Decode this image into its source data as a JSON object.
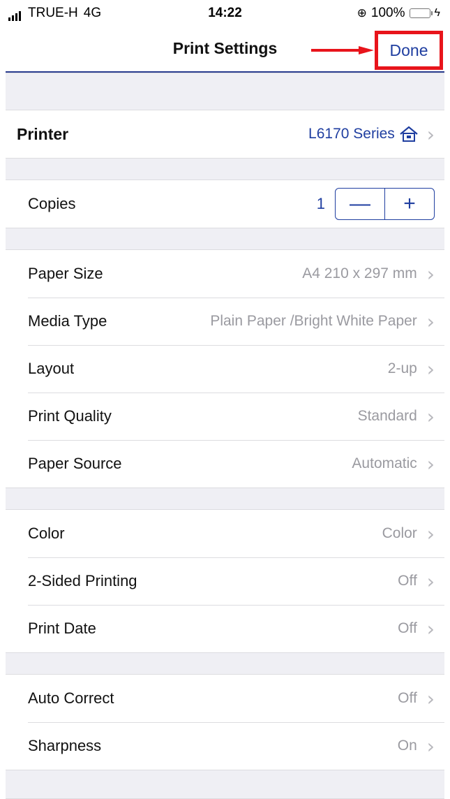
{
  "status_bar": {
    "carrier": "TRUE-H",
    "network": "4G",
    "time": "14:22",
    "battery": "100%"
  },
  "nav": {
    "title": "Print Settings",
    "done_label": "Done"
  },
  "printer": {
    "label": "Printer",
    "value": "L6170 Series"
  },
  "copies": {
    "label": "Copies",
    "value": "1",
    "minus": "—",
    "plus": "+"
  },
  "paper_section": [
    {
      "label": "Paper Size",
      "value": "A4 210 x 297 mm"
    },
    {
      "label": "Media Type",
      "value": "Plain Paper /Bright White Paper"
    },
    {
      "label": "Layout",
      "value": "2-up"
    },
    {
      "label": "Print Quality",
      "value": "Standard"
    },
    {
      "label": "Paper Source",
      "value": "Automatic"
    }
  ],
  "color_section": [
    {
      "label": "Color",
      "value": "Color"
    },
    {
      "label": "2-Sided Printing",
      "value": "Off"
    },
    {
      "label": "Print Date",
      "value": "Off"
    }
  ],
  "correction_section": [
    {
      "label": "Auto Correct",
      "value": "Off"
    },
    {
      "label": "Sharpness",
      "value": "On"
    }
  ],
  "colors": {
    "accent": "#1f3ea0",
    "highlight": "#e8141b",
    "separator": "#efeff4"
  }
}
